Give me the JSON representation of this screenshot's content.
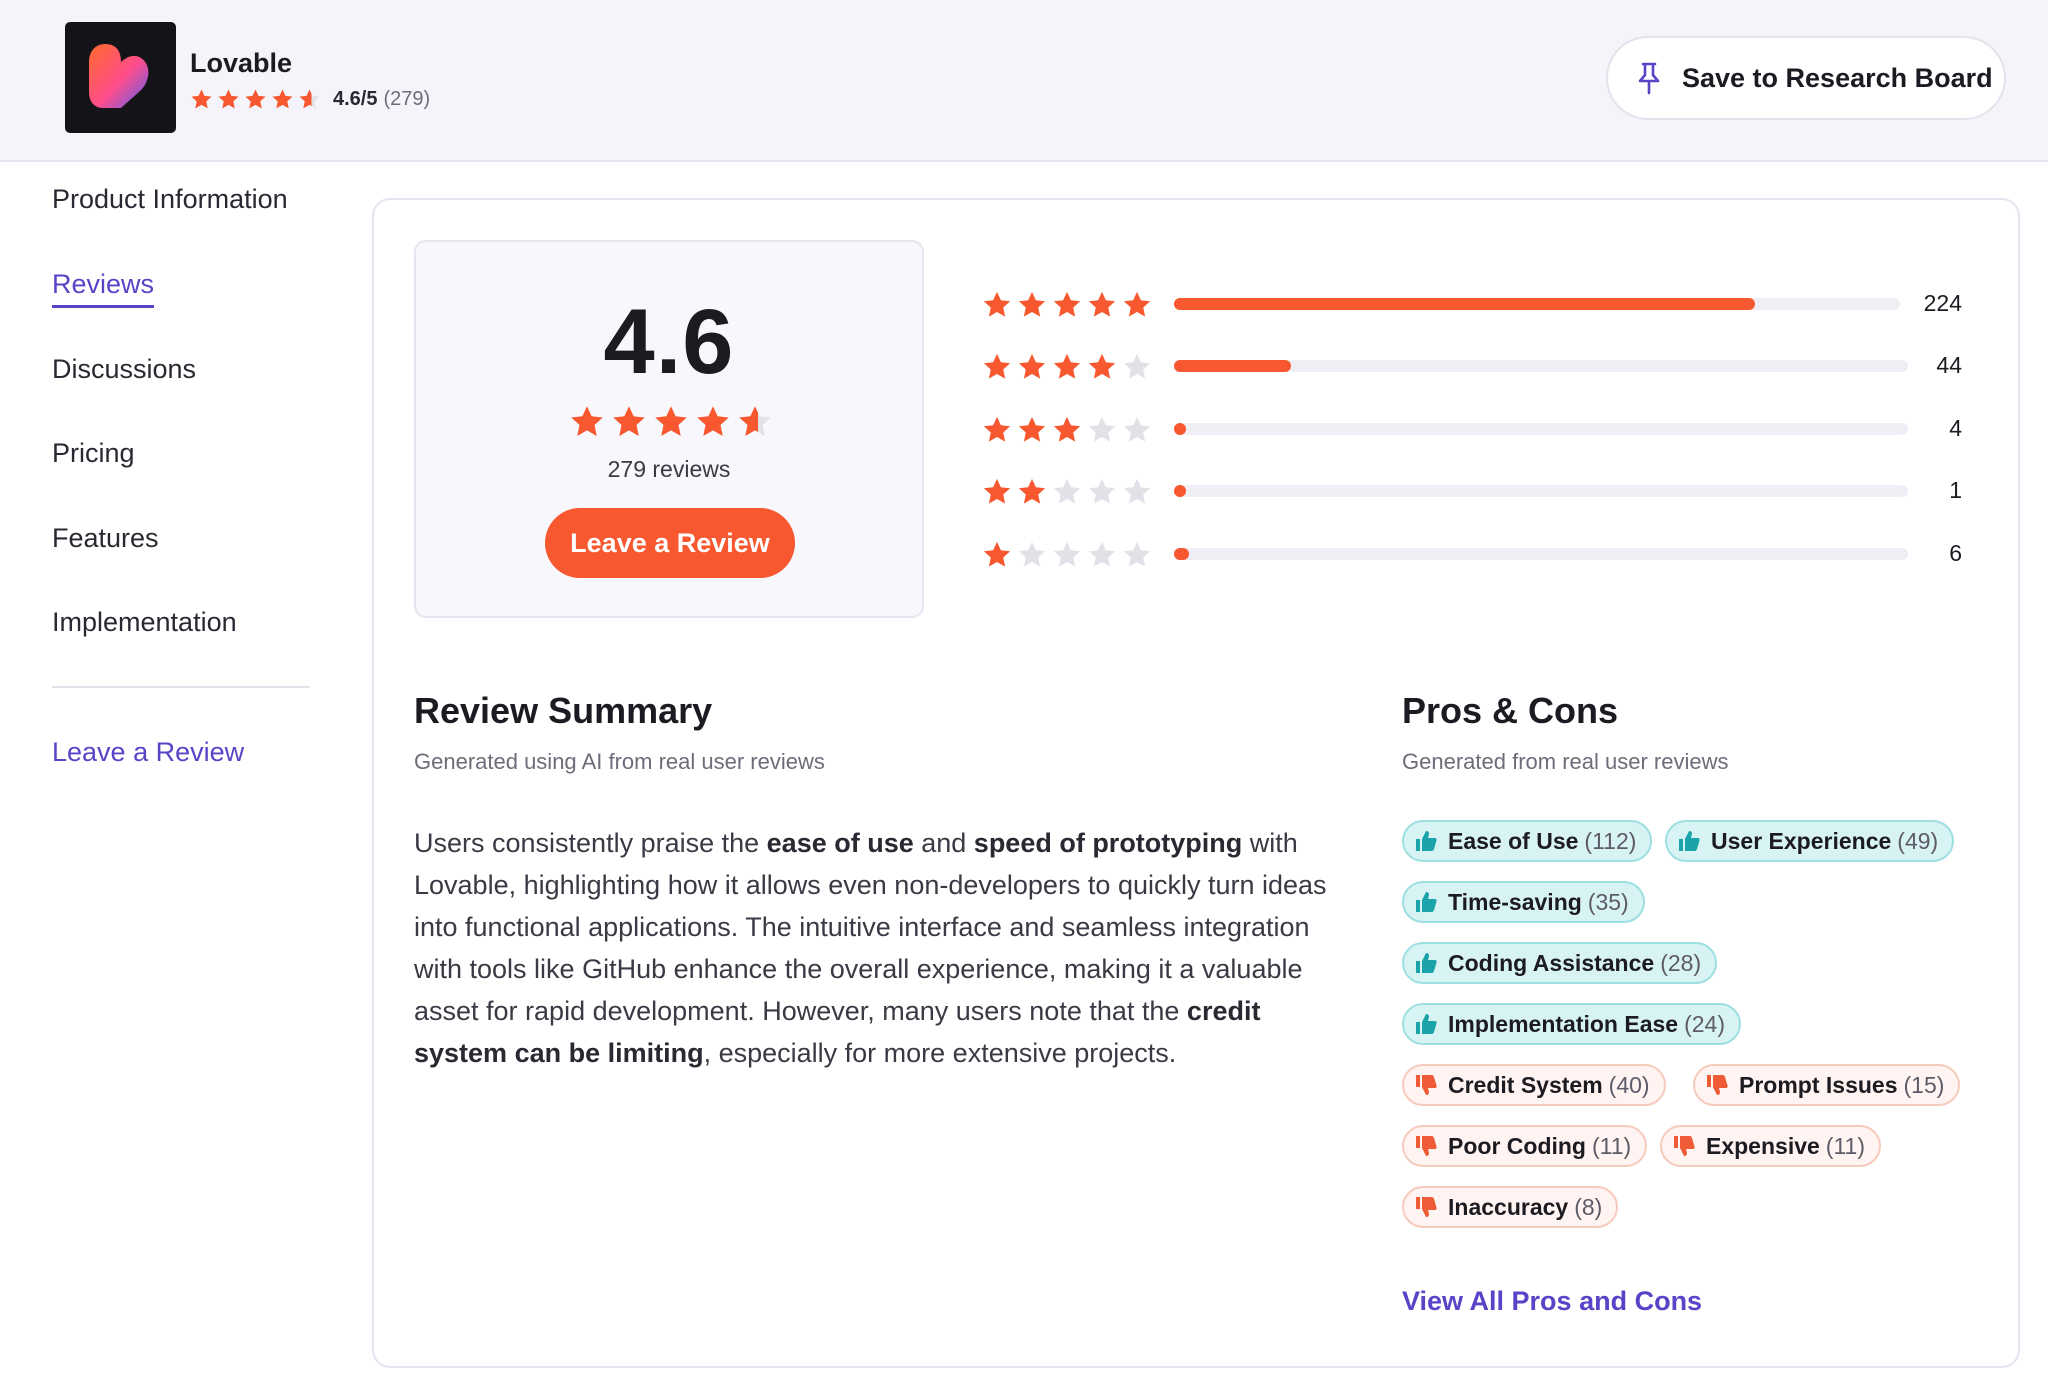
{
  "header": {
    "product_name": "Lovable",
    "rating_text": "4.6/5",
    "rating_count": "(279)",
    "save_label": "Save to Research Board"
  },
  "sidebar": {
    "items": [
      {
        "label": "Product Information",
        "active": false
      },
      {
        "label": "Reviews",
        "active": true
      },
      {
        "label": "Discussions",
        "active": false
      },
      {
        "label": "Pricing",
        "active": false
      },
      {
        "label": "Features",
        "active": false
      },
      {
        "label": "Implementation",
        "active": false
      }
    ],
    "leave_review": "Leave a Review"
  },
  "score": {
    "value": "4.6",
    "stars": 4.6,
    "reviews_label": "279 reviews",
    "leave_review_label": "Leave a Review"
  },
  "distribution": [
    {
      "stars": 5,
      "count": "224",
      "fraction": 0.8
    },
    {
      "stars": 4,
      "count": "44",
      "fraction": 0.16
    },
    {
      "stars": 3,
      "count": "4",
      "fraction": 0.014
    },
    {
      "stars": 2,
      "count": "1",
      "fraction": 0.004
    },
    {
      "stars": 1,
      "count": "6",
      "fraction": 0.021
    }
  ],
  "summary": {
    "title": "Review Summary",
    "subtitle": "Generated using AI from real user reviews",
    "text_parts": [
      {
        "t": "Users consistently praise the ",
        "b": false
      },
      {
        "t": "ease of use",
        "b": true
      },
      {
        "t": " and ",
        "b": false
      },
      {
        "t": "speed of prototyping",
        "b": true
      },
      {
        "t": " with Lovable, highlighting how it allows even non-developers to quickly turn ideas into functional applications. The intuitive interface and seamless integration with tools like GitHub enhance the overall experience, making it a valuable asset for rapid development. However, many users note that the ",
        "b": false
      },
      {
        "t": "credit system can be limiting",
        "b": true
      },
      {
        "t": ", especially for more extensive projects.",
        "b": false
      }
    ]
  },
  "pros_cons": {
    "title": "Pros & Cons",
    "subtitle": "Generated from real user reviews",
    "pros": [
      {
        "label": "Ease of Use",
        "count": "(112)"
      },
      {
        "label": "User Experience",
        "count": "(49)"
      },
      {
        "label": "Time-saving",
        "count": "(35)"
      },
      {
        "label": "Coding Assistance",
        "count": "(28)"
      },
      {
        "label": "Implementation Ease",
        "count": "(24)"
      }
    ],
    "cons": [
      {
        "label": "Credit System",
        "count": "(40)"
      },
      {
        "label": "Prompt Issues",
        "count": "(15)"
      },
      {
        "label": "Poor Coding",
        "count": "(11)"
      },
      {
        "label": "Expensive",
        "count": "(11)"
      },
      {
        "label": "Inaccuracy",
        "count": "(8)"
      }
    ],
    "view_all": "View All Pros and Cons"
  },
  "colors": {
    "accent": "#f7582f",
    "link": "#5b43c8",
    "pro_bg": "#d8f3f4",
    "pro_icon": "#1aa3a9",
    "con_bg": "#fff4f1",
    "con_icon": "#ef5b36"
  },
  "icons": {
    "logo": "lovable-heart-logo",
    "pin": "pin-icon",
    "pro": "thumbs-up-icon",
    "con": "thumbs-down-icon",
    "star": "star-icon"
  }
}
